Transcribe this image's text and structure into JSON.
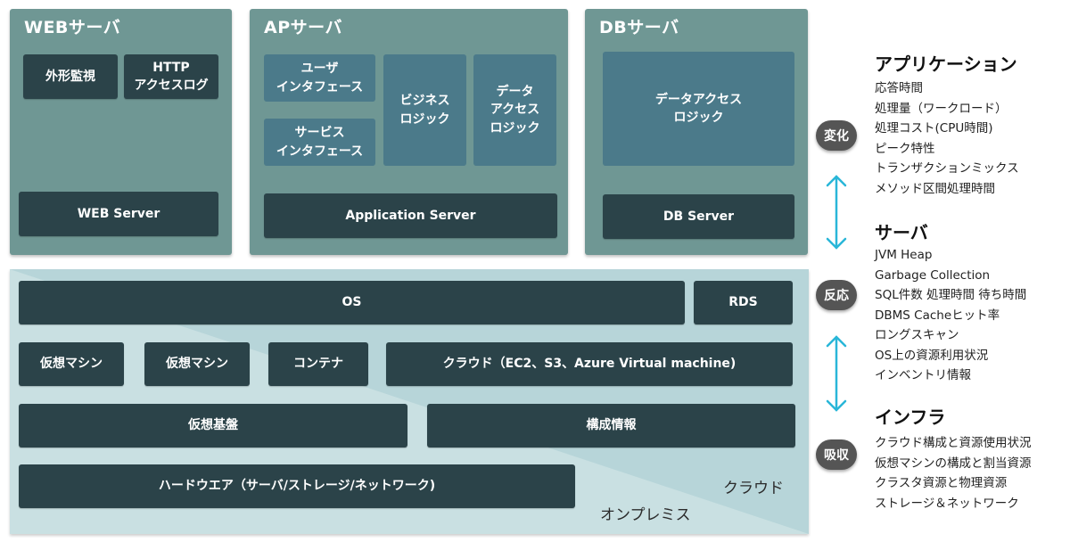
{
  "colors": {
    "panel": "#6f9794",
    "dark_block": "#2b4349",
    "mid_block": "#4b7a8a",
    "onprem_bg": "#c9e0e2",
    "cloud_bg": "#b7d5d9",
    "arrow": "#29b6d8",
    "badge": "#555555"
  },
  "servers": {
    "web": {
      "title": "WEBサーバ",
      "items": [
        "外形監視",
        "HTTP\nアクセスログ"
      ],
      "base": "WEB Server"
    },
    "ap": {
      "title": "APサーバ",
      "items": [
        "ユーザ\nインタフェース",
        "サービス\nインタフェース",
        "ビジネス\nロジック",
        "データ\nアクセス\nロジック"
      ],
      "base": "Application Server"
    },
    "db": {
      "title": "DBサーバ",
      "items": [
        "データアクセス\nロジック"
      ],
      "base": "DB Server"
    }
  },
  "infra": {
    "row1": [
      "OS",
      "RDS"
    ],
    "row2": [
      "仮想マシン",
      "仮想マシン",
      "コンテナ",
      "クラウド（EC2、S3、Azure Virtual machine)"
    ],
    "row3": [
      "仮想基盤",
      "構成情報"
    ],
    "row4": [
      "ハードウエア（サーバ/ストレージ/ネットワーク)"
    ],
    "zone_cloud": "クラウド",
    "zone_onprem": "オンプレミス"
  },
  "badges": [
    "変化",
    "反応",
    "吸収"
  ],
  "categories": [
    {
      "title": "アプリケーション",
      "items": [
        "応答時間",
        "処理量（ワークロード）",
        "処理コスト(CPU時間)",
        "ピーク特性",
        "トランザクションミックス",
        "メソッド区間処理時間"
      ]
    },
    {
      "title": "サーバ",
      "items": [
        "JVM Heap",
        "Garbage Collection",
        "SQL件数 処理時間 待ち時間",
        "DBMS Cacheヒット率",
        "ロングスキャン",
        "OS上の資源利用状況",
        "インベントリ情報"
      ]
    },
    {
      "title": "インフラ",
      "items": [
        "クラウド構成と資源使用状況",
        "仮想マシンの構成と割当資源",
        "クラスタ資源と物理資源",
        "ストレージ＆ネットワーク"
      ]
    }
  ]
}
